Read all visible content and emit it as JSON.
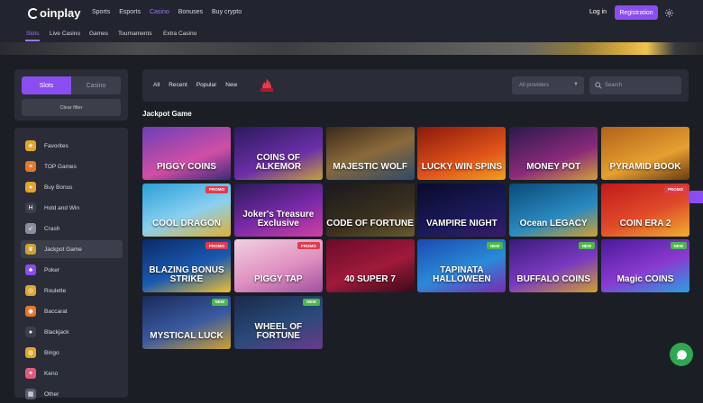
{
  "brand": {
    "name_rest": "oinplay"
  },
  "nav": {
    "items": [
      "Sports",
      "Esports",
      "Casino",
      "Bonuses",
      "Buy crypto"
    ],
    "active": "Casino"
  },
  "auth": {
    "login": "Log in",
    "register": "Registration"
  },
  "subnav": {
    "items": [
      "Slots",
      "Live Casino",
      "Games",
      "Tournaments",
      "Extra Casino"
    ],
    "active": "Slots"
  },
  "sidebar": {
    "tabs": [
      "Slots",
      "Casino"
    ],
    "clear_filter": "Clear filter",
    "categories": [
      {
        "label": "Favorites",
        "icon": "star-icon"
      },
      {
        "label": "TOP Games",
        "icon": "burger-icon"
      },
      {
        "label": "Buy Bonus",
        "icon": "coins-icon"
      },
      {
        "label": "Hold and Win",
        "icon": "h-icon"
      },
      {
        "label": "Crash",
        "icon": "rocket-icon"
      },
      {
        "label": "Jackpot Game",
        "icon": "crown-icon"
      },
      {
        "label": "Poker",
        "icon": "clubs-icon"
      },
      {
        "label": "Roulette",
        "icon": "roulette-icon"
      },
      {
        "label": "Baccarat",
        "icon": "chip-icon"
      },
      {
        "label": "Blackjack",
        "icon": "card-icon"
      },
      {
        "label": "Bingo",
        "icon": "bingo-icon"
      },
      {
        "label": "Keno",
        "icon": "keno-icon"
      },
      {
        "label": "Other",
        "icon": "grid-icon"
      }
    ],
    "active_category": "Jackpot Game"
  },
  "filters": {
    "items": [
      "All",
      "Recent",
      "Popular",
      "New"
    ],
    "providers_placeholder": "All providers",
    "search_placeholder": "Search"
  },
  "section": {
    "title": "Jackpot Game"
  },
  "games": [
    {
      "title": "PIGGY COINS",
      "badge": "",
      "bg": "linear-gradient(160deg,#6b3fb8,#d14fa5 60%,#3b2a7a)"
    },
    {
      "title": "COINS OF ALKEMOR",
      "badge": "",
      "bg": "linear-gradient(160deg,#2b1a5e,#6b2fa8 60%,#c7a13a)"
    },
    {
      "title": "MAJESTIC WOLF",
      "badge": "",
      "bg": "linear-gradient(160deg,#3a2a1a,#8a6a3a 50%,#2e4a6a)"
    },
    {
      "title": "LUCKY WIN SPINS",
      "badge": "",
      "bg": "linear-gradient(160deg,#8a1a0a,#e0521a 60%,#f0a020)"
    },
    {
      "title": "MONEY POT",
      "badge": "",
      "bg": "linear-gradient(160deg,#2a1a4a,#8a2a7a 60%,#d0a03a)"
    },
    {
      "title": "PYRAMID BOOK",
      "badge": "",
      "bg": "linear-gradient(160deg,#b0621a,#e6a030 60%,#6a3a10)"
    },
    {
      "title": "COOL DRAGON",
      "badge": "PROMO",
      "bg": "linear-gradient(160deg,#2aa0d8,#8ad0f0 55%,#e0b030)"
    },
    {
      "title": "Joker's Treasure Exclusive",
      "badge": "",
      "bg": "linear-gradient(160deg,#2a1a5a,#7a2aa8 55%,#d040a0)"
    },
    {
      "title": "CODE OF FORTUNE",
      "badge": "",
      "bg": "linear-gradient(160deg,#1a1a1a,#3a3020 60%,#6a5a30)"
    },
    {
      "title": "VAMPIRE NIGHT",
      "badge": "",
      "bg": "linear-gradient(160deg,#0a0a2a,#1a1a5a 60%,#3a1a6a)"
    },
    {
      "title": "Ocean LEGACY",
      "badge": "",
      "bg": "linear-gradient(160deg,#0a4a7a,#2a8ac0 60%,#d0a030)"
    },
    {
      "title": "COIN ERA 2",
      "badge": "PROMO",
      "bg": "linear-gradient(160deg,#c01a1a,#e04a2a 55%,#f0b030)"
    },
    {
      "title": "BLAZING BONUS STRIKE",
      "badge": "PROMO",
      "bg": "linear-gradient(160deg,#0a2a6a,#1a5ab0 55%,#f0c030)"
    },
    {
      "title": "PIGGY TAP",
      "badge": "PROMO",
      "bg": "linear-gradient(160deg,#f0d0e0,#e090c0 55%,#a050a0)"
    },
    {
      "title": "40 SUPER 7",
      "badge": "",
      "bg": "linear-gradient(160deg,#6a0a2a,#a01a3a 55%,#3a0a1a)"
    },
    {
      "title": "TAPINATA HALLOWEEN",
      "badge": "NEW",
      "bg": "linear-gradient(160deg,#1a4ab0,#2a8ad8 55%,#7a2ab0)"
    },
    {
      "title": "BUFFALO COINS",
      "badge": "NEW",
      "bg": "linear-gradient(160deg,#3a1a7a,#7a3ac0 55%,#d0a030)"
    },
    {
      "title": "Magic COINS",
      "badge": "NEW",
      "bg": "linear-gradient(160deg,#4a1a9a,#8a3ad0 55%,#2aa0e0)"
    },
    {
      "title": "MYSTICAL LUCK",
      "badge": "NEW",
      "bg": "linear-gradient(160deg,#1a2a5a,#3a5aa0 55%,#d0a030)"
    },
    {
      "title": "WHEEL OF FORTUNE",
      "badge": "NEW",
      "bg": "linear-gradient(160deg,#1a2a4a,#2a4a7a 55%,#6a3a8a)"
    }
  ],
  "colors": {
    "accent": "#8a4df0",
    "bg": "#1c1e26",
    "panel": "#2a2d38",
    "promo": "#e23b4e",
    "new": "#4cb84a",
    "chat": "#2fa84f"
  }
}
